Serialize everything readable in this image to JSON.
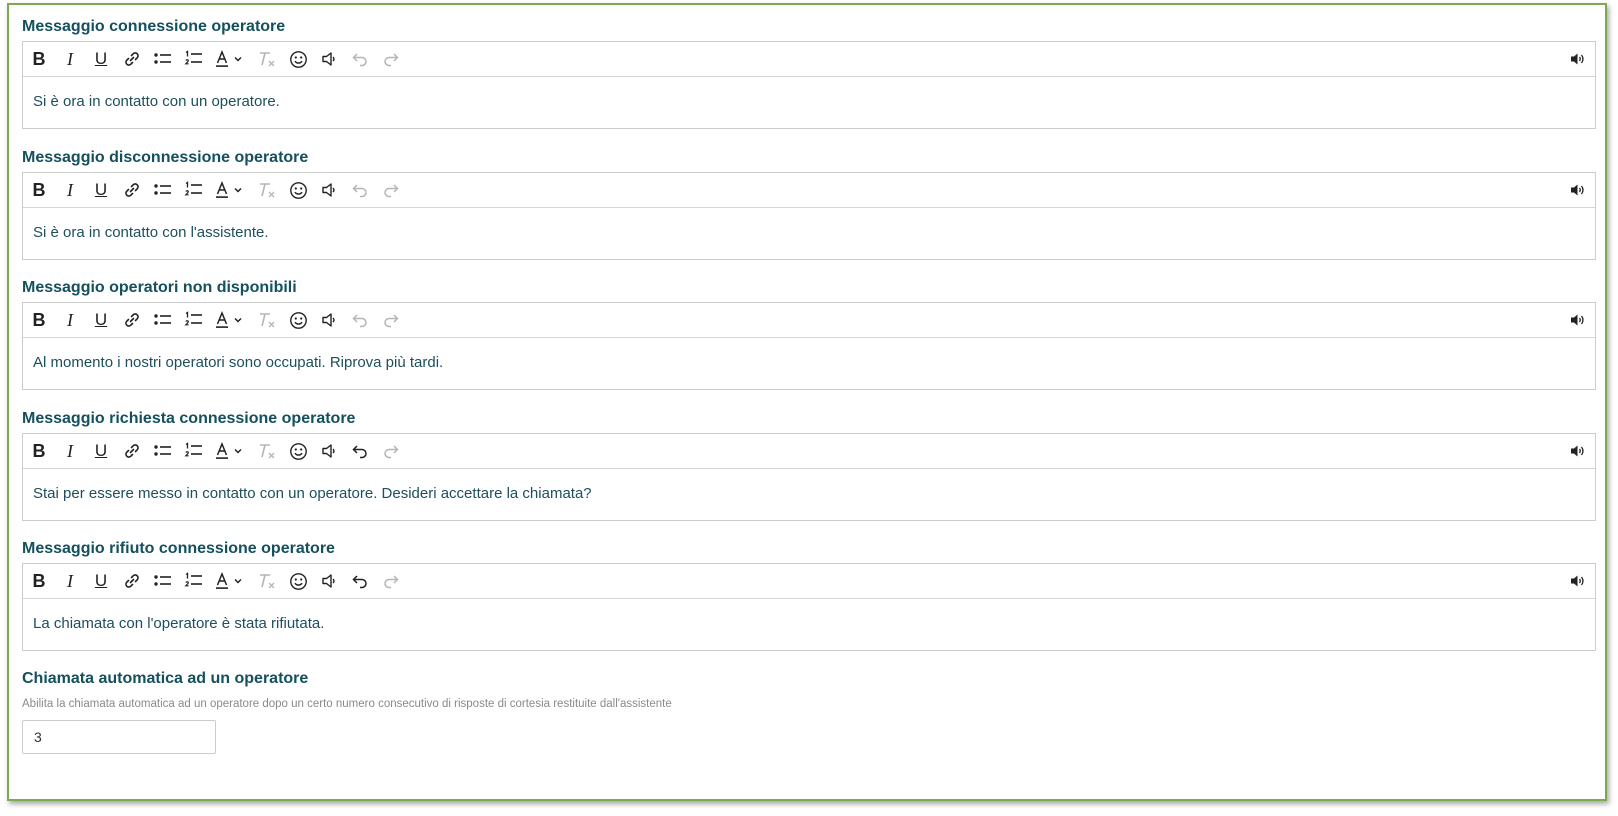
{
  "editors": [
    {
      "label": "Messaggio connessione operatore",
      "content": "Si è ora in contatto con un operatore.",
      "undo_enabled": false
    },
    {
      "label": "Messaggio disconnessione operatore",
      "content": "Si è ora in contatto con l'assistente.",
      "undo_enabled": false
    },
    {
      "label": "Messaggio operatori non disponibili",
      "content": "Al momento i nostri operatori sono occupati. Riprova più tardi.",
      "undo_enabled": false
    },
    {
      "label": "Messaggio richiesta connessione operatore",
      "content": "Stai per essere messo in contatto con un operatore. Desideri accettare la chiamata?",
      "undo_enabled": true
    },
    {
      "label": "Messaggio rifiuto connessione operatore",
      "content": "La chiamata con l'operatore è stata rifiutata.",
      "undo_enabled": true
    }
  ],
  "toolbar": {
    "bold": "B",
    "italic": "I",
    "underline": "U",
    "font_color": "A",
    "clear_format": "T",
    "icons": [
      "bold-icon",
      "italic-icon",
      "underline-icon",
      "link-icon",
      "bullet-list-icon",
      "numbered-list-icon",
      "font-color-icon",
      "clear-format-icon",
      "emoji-icon",
      "speaker-icon",
      "undo-icon",
      "redo-icon",
      "speaker-volume-icon"
    ]
  },
  "auto_call": {
    "label": "Chiamata automatica ad un operatore",
    "description": "Abilita la chiamata automatica ad un operatore dopo un certo numero consecutivo di risposte di cortesia restituite dall'assistente",
    "value": "3"
  },
  "colors": {
    "frame_border": "#7aab4e",
    "label": "#15505e",
    "content_text": "#1d4f5c",
    "disabled_icon": "#b5b5b5"
  }
}
